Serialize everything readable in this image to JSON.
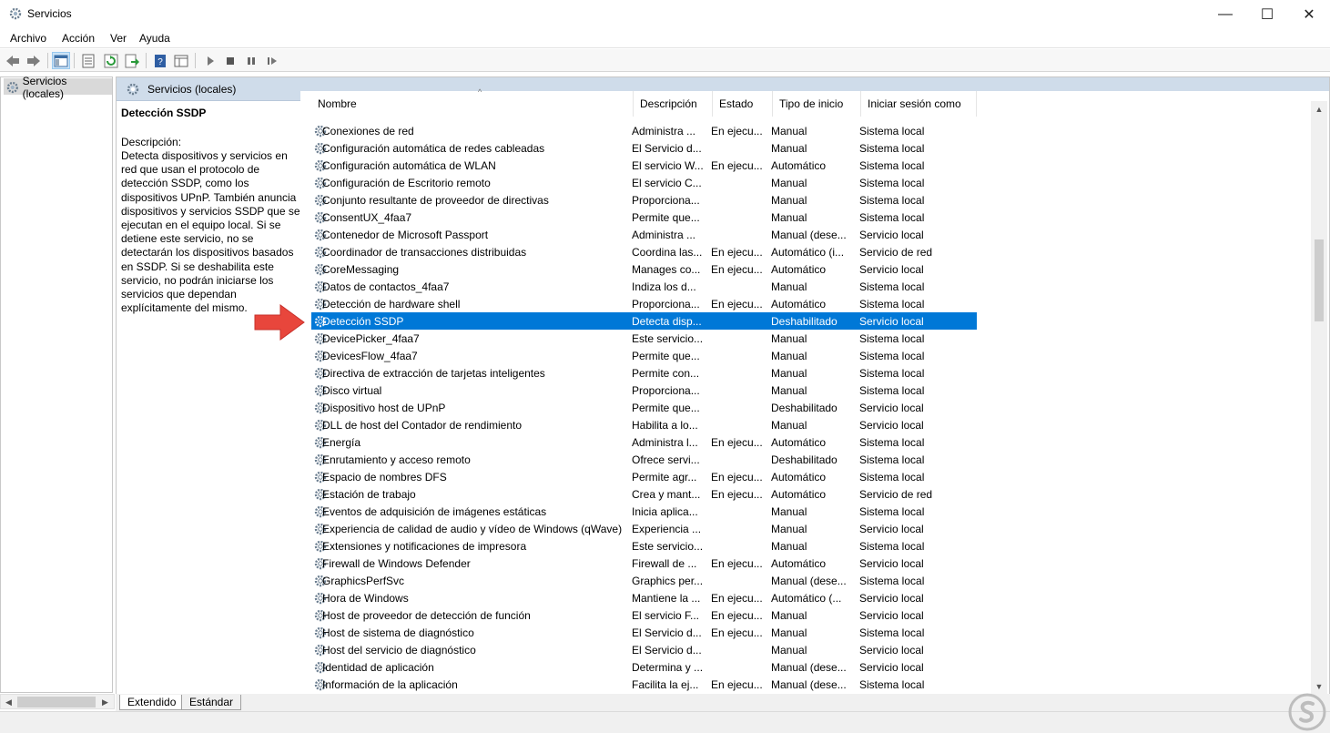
{
  "window": {
    "title": "Servicios",
    "minimize": "—",
    "maximize": "☐",
    "close": "✕"
  },
  "menu": [
    "Archivo",
    "Acción",
    "Ver",
    "Ayuda"
  ],
  "toolbar": {
    "icons": [
      "back-icon",
      "forward-icon",
      "show-hide-tree-icon",
      "properties-icon",
      "refresh-icon",
      "export-list-icon",
      "help-icon",
      "view-icon",
      "start-service-icon",
      "stop-service-icon",
      "pause-service-icon",
      "resume-service-icon"
    ]
  },
  "tree": {
    "label": "Servicios (locales)"
  },
  "header": {
    "label": "Servicios (locales)"
  },
  "description": {
    "title": "Detección SSDP",
    "label": "Descripción:",
    "text": "Detecta dispositivos y servicios en red que usan el protocolo de detección SSDP, como los dispositivos UPnP. También anuncia dispositivos y servicios SSDP que se ejecutan en el equipo local. Si se detiene este servicio, no se detectarán los dispositivos basados en SSDP. Si se deshabilita este servicio, no podrán iniciarse los servicios que dependan explícitamente del mismo."
  },
  "columns": [
    "Nombre",
    "Descripción",
    "Estado",
    "Tipo de inicio",
    "Iniciar sesión como"
  ],
  "selected_row": 11,
  "rows": [
    {
      "name": "Conexiones de red",
      "desc": "Administra ...",
      "status": "En ejecu...",
      "start": "Manual",
      "logon": "Sistema local"
    },
    {
      "name": "Configuración automática de redes cableadas",
      "desc": "El Servicio d...",
      "status": "",
      "start": "Manual",
      "logon": "Sistema local"
    },
    {
      "name": "Configuración automática de WLAN",
      "desc": "El servicio W...",
      "status": "En ejecu...",
      "start": "Automático",
      "logon": "Sistema local"
    },
    {
      "name": "Configuración de Escritorio remoto",
      "desc": "El servicio C...",
      "status": "",
      "start": "Manual",
      "logon": "Sistema local"
    },
    {
      "name": "Conjunto resultante de proveedor de directivas",
      "desc": "Proporciona...",
      "status": "",
      "start": "Manual",
      "logon": "Sistema local"
    },
    {
      "name": "ConsentUX_4faa7",
      "desc": "Permite que...",
      "status": "",
      "start": "Manual",
      "logon": "Sistema local"
    },
    {
      "name": "Contenedor de Microsoft Passport",
      "desc": "Administra ...",
      "status": "",
      "start": "Manual (dese...",
      "logon": "Servicio local"
    },
    {
      "name": "Coordinador de transacciones distribuidas",
      "desc": "Coordina las...",
      "status": "En ejecu...",
      "start": "Automático (i...",
      "logon": "Servicio de red"
    },
    {
      "name": "CoreMessaging",
      "desc": "Manages co...",
      "status": "En ejecu...",
      "start": "Automático",
      "logon": "Servicio local"
    },
    {
      "name": "Datos de contactos_4faa7",
      "desc": "Indiza los d...",
      "status": "",
      "start": "Manual",
      "logon": "Sistema local"
    },
    {
      "name": "Detección de hardware shell",
      "desc": "Proporciona...",
      "status": "En ejecu...",
      "start": "Automático",
      "logon": "Sistema local"
    },
    {
      "name": "Detección SSDP",
      "desc": "Detecta disp...",
      "status": "",
      "start": "Deshabilitado",
      "logon": "Servicio local"
    },
    {
      "name": "DevicePicker_4faa7",
      "desc": "Este servicio...",
      "status": "",
      "start": "Manual",
      "logon": "Sistema local"
    },
    {
      "name": "DevicesFlow_4faa7",
      "desc": "Permite que...",
      "status": "",
      "start": "Manual",
      "logon": "Sistema local"
    },
    {
      "name": "Directiva de extracción de tarjetas inteligentes",
      "desc": "Permite con...",
      "status": "",
      "start": "Manual",
      "logon": "Sistema local"
    },
    {
      "name": "Disco virtual",
      "desc": "Proporciona...",
      "status": "",
      "start": "Manual",
      "logon": "Sistema local"
    },
    {
      "name": "Dispositivo host de UPnP",
      "desc": "Permite que...",
      "status": "",
      "start": "Deshabilitado",
      "logon": "Servicio local"
    },
    {
      "name": "DLL de host del Contador de rendimiento",
      "desc": "Habilita a lo...",
      "status": "",
      "start": "Manual",
      "logon": "Servicio local"
    },
    {
      "name": "Energía",
      "desc": "Administra l...",
      "status": "En ejecu...",
      "start": "Automático",
      "logon": "Sistema local"
    },
    {
      "name": "Enrutamiento y acceso remoto",
      "desc": "Ofrece servi...",
      "status": "",
      "start": "Deshabilitado",
      "logon": "Sistema local"
    },
    {
      "name": "Espacio de nombres DFS",
      "desc": "Permite agr...",
      "status": "En ejecu...",
      "start": "Automático",
      "logon": "Sistema local"
    },
    {
      "name": "Estación de trabajo",
      "desc": "Crea y mant...",
      "status": "En ejecu...",
      "start": "Automático",
      "logon": "Servicio de red"
    },
    {
      "name": "Eventos de adquisición de imágenes estáticas",
      "desc": "Inicia aplica...",
      "status": "",
      "start": "Manual",
      "logon": "Sistema local"
    },
    {
      "name": "Experiencia de calidad de audio y vídeo de Windows (qWave)",
      "desc": "Experiencia ...",
      "status": "",
      "start": "Manual",
      "logon": "Servicio local"
    },
    {
      "name": "Extensiones y notificaciones de impresora",
      "desc": "Este servicio...",
      "status": "",
      "start": "Manual",
      "logon": "Sistema local"
    },
    {
      "name": "Firewall de Windows Defender",
      "desc": "Firewall de ...",
      "status": "En ejecu...",
      "start": "Automático",
      "logon": "Servicio local"
    },
    {
      "name": "GraphicsPerfSvc",
      "desc": "Graphics per...",
      "status": "",
      "start": "Manual (dese...",
      "logon": "Sistema local"
    },
    {
      "name": "Hora de Windows",
      "desc": "Mantiene la ...",
      "status": "En ejecu...",
      "start": "Automático (...",
      "logon": "Servicio local"
    },
    {
      "name": "Host de proveedor de detección de función",
      "desc": "El servicio F...",
      "status": "En ejecu...",
      "start": "Manual",
      "logon": "Servicio local"
    },
    {
      "name": "Host de sistema de diagnóstico",
      "desc": "El Servicio d...",
      "status": "En ejecu...",
      "start": "Manual",
      "logon": "Sistema local"
    },
    {
      "name": "Host del servicio de diagnóstico",
      "desc": "El Servicio d...",
      "status": "",
      "start": "Manual",
      "logon": "Servicio local"
    },
    {
      "name": "Identidad de aplicación",
      "desc": "Determina y ...",
      "status": "",
      "start": "Manual (dese...",
      "logon": "Servicio local"
    },
    {
      "name": "Información de la aplicación",
      "desc": "Facilita la ej...",
      "status": "En ejecu...",
      "start": "Manual (dese...",
      "logon": "Sistema local"
    }
  ],
  "tabs": [
    "Extendido",
    "Estándar"
  ],
  "colors": {
    "selection": "#0078d7",
    "header_band": "#cfdcea",
    "annotation_arrow": "#e8463c"
  }
}
